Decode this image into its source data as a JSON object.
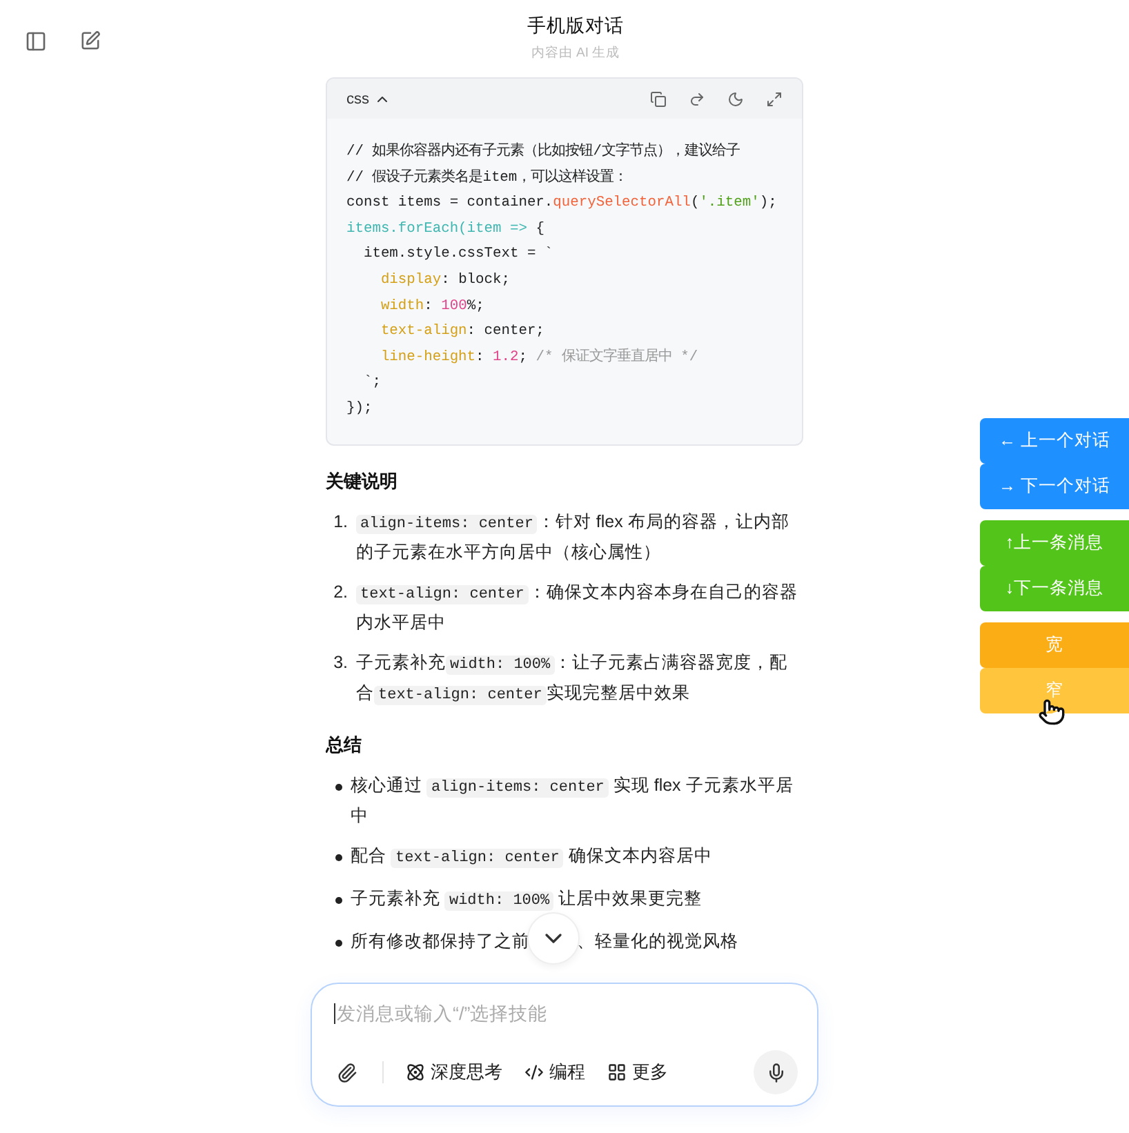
{
  "header": {
    "title": "手机版对话",
    "subtitle": "内容由 AI 生成"
  },
  "code_block": {
    "language": "css",
    "lines": [
      [
        {
          "kind": "comment_dark",
          "text": "// 如果你容器内还有子元素（比如按钮/文字节点），建议给子"
        }
      ],
      [
        {
          "kind": "comment_dark",
          "text": "// 假设子元素类名是item，可以这样设置："
        }
      ],
      [
        {
          "kind": "plain",
          "text": "const items = container."
        },
        {
          "kind": "func",
          "text": "querySelectorAll"
        },
        {
          "kind": "plain",
          "text": "("
        },
        {
          "kind": "string",
          "text": "'.item'"
        },
        {
          "kind": "plain",
          "text": ");"
        }
      ],
      [
        {
          "kind": "teal",
          "text": "items.forEach(item => "
        },
        {
          "kind": "plain",
          "text": "{"
        }
      ],
      [
        {
          "kind": "plain",
          "text": "  item.style.cssText = `"
        }
      ],
      [
        {
          "kind": "prop",
          "text": "    display"
        },
        {
          "kind": "plain",
          "text": ": block;"
        }
      ],
      [
        {
          "kind": "prop",
          "text": "    width"
        },
        {
          "kind": "plain",
          "text": ": "
        },
        {
          "kind": "number",
          "text": "100"
        },
        {
          "kind": "plain",
          "text": "%;"
        }
      ],
      [
        {
          "kind": "prop",
          "text": "    text-align"
        },
        {
          "kind": "plain",
          "text": ": center;"
        }
      ],
      [
        {
          "kind": "prop",
          "text": "    line-height"
        },
        {
          "kind": "plain",
          "text": ": "
        },
        {
          "kind": "number",
          "text": "1.2"
        },
        {
          "kind": "plain",
          "text": "; "
        },
        {
          "kind": "comment",
          "text": "/* 保证文字垂直居中 */"
        }
      ],
      [
        {
          "kind": "plain",
          "text": "  `;"
        }
      ],
      [
        {
          "kind": "plain",
          "text": "});"
        }
      ]
    ]
  },
  "sections": [
    {
      "heading": "关键说明",
      "items": [
        {
          "marker": "1.",
          "parts": [
            {
              "kind": "code",
              "text": "align-items: center"
            },
            {
              "kind": "text",
              "text": "：针对 flex 布局的容器，让内部的子元素在水平方向居中（核心属性）"
            }
          ]
        },
        {
          "marker": "2.",
          "parts": [
            {
              "kind": "code",
              "text": "text-align: center"
            },
            {
              "kind": "text",
              "text": "：确保文本内容本身在自己的容器内水平居中"
            }
          ]
        },
        {
          "marker": "3.",
          "parts": [
            {
              "kind": "text",
              "text": "子元素补充"
            },
            {
              "kind": "code",
              "text": "width: 100%"
            },
            {
              "kind": "text",
              "text": "：让子元素占满容器宽度，配合"
            },
            {
              "kind": "code",
              "text": "text-align: center"
            },
            {
              "kind": "text",
              "text": "实现完整居中效果"
            }
          ]
        }
      ]
    },
    {
      "heading": "总结",
      "items": [
        {
          "parts": [
            {
              "kind": "text",
              "text": "核心通过 "
            },
            {
              "kind": "code",
              "text": "align-items: center"
            },
            {
              "kind": "text",
              "text": " 实现 flex 子元素水平居中"
            }
          ]
        },
        {
          "parts": [
            {
              "kind": "text",
              "text": "配合 "
            },
            {
              "kind": "code",
              "text": "text-align: center"
            },
            {
              "kind": "text",
              "text": " 确保文本内容居中"
            }
          ]
        },
        {
          "parts": [
            {
              "kind": "text",
              "text": "子元素补充 "
            },
            {
              "kind": "code",
              "text": "width: 100%"
            },
            {
              "kind": "text",
              "text": " 让居中效果更完整"
            }
          ]
        },
        {
          "parts": [
            {
              "kind": "text",
              "text": "所有修改都保持了之前"
            },
            {
              "kind": "gap"
            },
            {
              "kind": "text",
              "text": "、轻量化的视觉风格"
            }
          ]
        }
      ]
    }
  ],
  "side_button_groups": [
    [
      {
        "label": "← 上一个对话",
        "color": "#1e90ff"
      },
      {
        "label": "→ 下一个对话",
        "color": "#1e90ff"
      }
    ],
    [
      {
        "label": "↑上一条消息",
        "color": "#52c41a"
      },
      {
        "label": "↓下一条消息",
        "color": "#52c41a"
      }
    ],
    [
      {
        "label": "宽",
        "color": "#faad14"
      },
      {
        "label": "窄",
        "color": "#ffc53d"
      }
    ]
  ],
  "composer": {
    "placeholder": "发消息或输入“/”选择技能",
    "tools": [
      {
        "kind": "think",
        "label": "深度思考"
      },
      {
        "kind": "code",
        "label": "编程"
      },
      {
        "kind": "more",
        "label": "更多"
      }
    ]
  }
}
